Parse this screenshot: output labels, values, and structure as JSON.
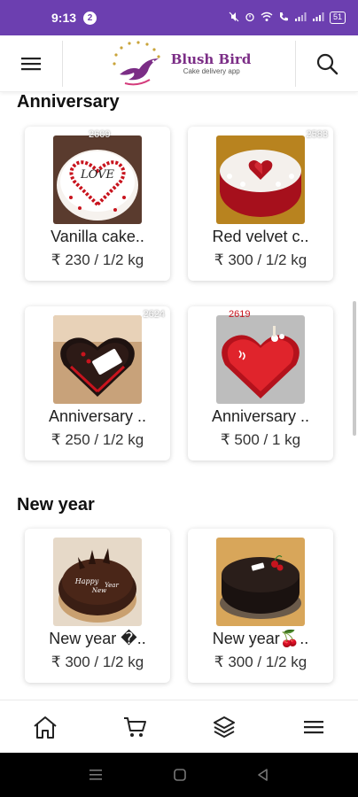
{
  "status_bar": {
    "time": "9:13",
    "notification_count": "2",
    "battery": "51"
  },
  "header": {
    "brand_name": "Blush Bird",
    "brand_tagline": "Cake delivery app"
  },
  "sections": [
    {
      "title": "Anniversary",
      "items": [
        {
          "name": "Vanilla cake..",
          "price": "₹ 230 / 1/2 kg",
          "id": "2609",
          "image": "vanilla-love-cake"
        },
        {
          "name": "Red velvet c..",
          "price": "₹ 300 / 1/2 kg",
          "id": "2583",
          "image": "red-velvet-heart-cake"
        },
        {
          "name": "Anniversary ..",
          "price": "₹ 250 / 1/2 kg",
          "id": "2624",
          "image": "chocolate-heart-cake"
        },
        {
          "name": "Anniversary ..",
          "price": "₹ 500 / 1 kg",
          "id": "2619",
          "image": "red-heart-cake"
        }
      ]
    },
    {
      "title": "New year",
      "items": [
        {
          "name": "New year �..",
          "price": "₹ 300 / 1/2 kg",
          "id": "",
          "image": "happy-new-year-chocolate-cake"
        },
        {
          "name": "New year🍒..",
          "price": "₹ 300 / 1/2 kg",
          "id": "",
          "image": "dark-chocolate-cake"
        }
      ]
    }
  ],
  "bottom_nav": [
    {
      "icon": "home-icon"
    },
    {
      "icon": "cart-icon"
    },
    {
      "icon": "layers-icon"
    },
    {
      "icon": "menu-icon"
    }
  ],
  "colors": {
    "status_bar": "#6c3fb0",
    "brand": "#7b2d86"
  }
}
